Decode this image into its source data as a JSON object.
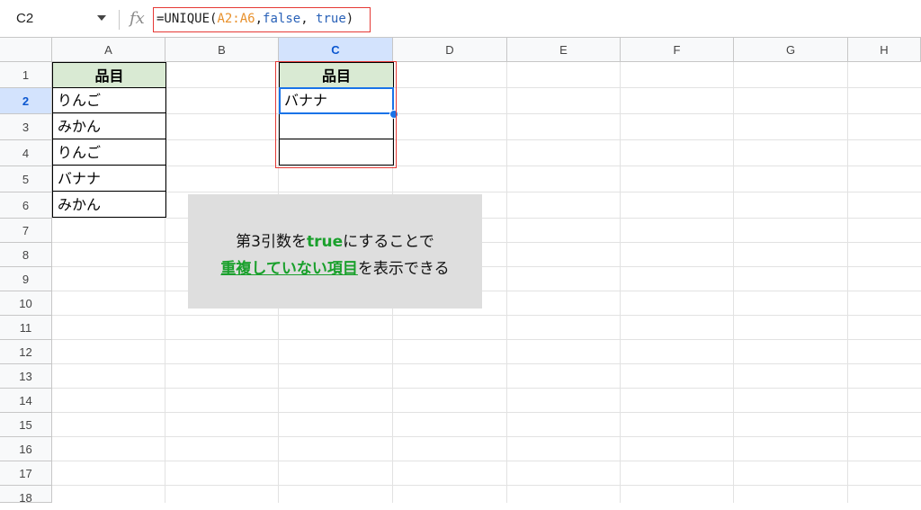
{
  "formula_bar": {
    "cell_ref": "C2",
    "fx_label": "fx",
    "formula_prefix": "=UNIQUE(",
    "formula_range": "A2:A6",
    "formula_comma1": ",",
    "formula_false": "false",
    "formula_comma2": ", ",
    "formula_true": "true",
    "formula_suffix": ")"
  },
  "columns": [
    "A",
    "B",
    "C",
    "D",
    "E",
    "F",
    "G",
    "H"
  ],
  "selected_column": "C",
  "rows": [
    "1",
    "2",
    "3",
    "4",
    "5",
    "6",
    "7",
    "8",
    "9",
    "10",
    "11",
    "12",
    "13",
    "14",
    "15",
    "16",
    "17",
    "18"
  ],
  "selected_row": "2",
  "cells": {
    "A1": "品目",
    "A2": "りんご",
    "A3": "みかん",
    "A4": "りんご",
    "A5": "バナナ",
    "A6": "みかん",
    "C1": "品目",
    "C2": "バナナ",
    "C3": "",
    "C4": ""
  },
  "note": {
    "line1_before": "第3引数を",
    "line1_highlight": "true",
    "line1_after": "にすることで",
    "line2_highlight": "重複していない項目",
    "line2_after": "を表示できる"
  },
  "colors": {
    "header_fill": "#d9ead3",
    "selection": "#1a73e8",
    "annotation_red": "#e53935",
    "highlight_green": "#1aa02c",
    "note_bg": "#dedede"
  }
}
